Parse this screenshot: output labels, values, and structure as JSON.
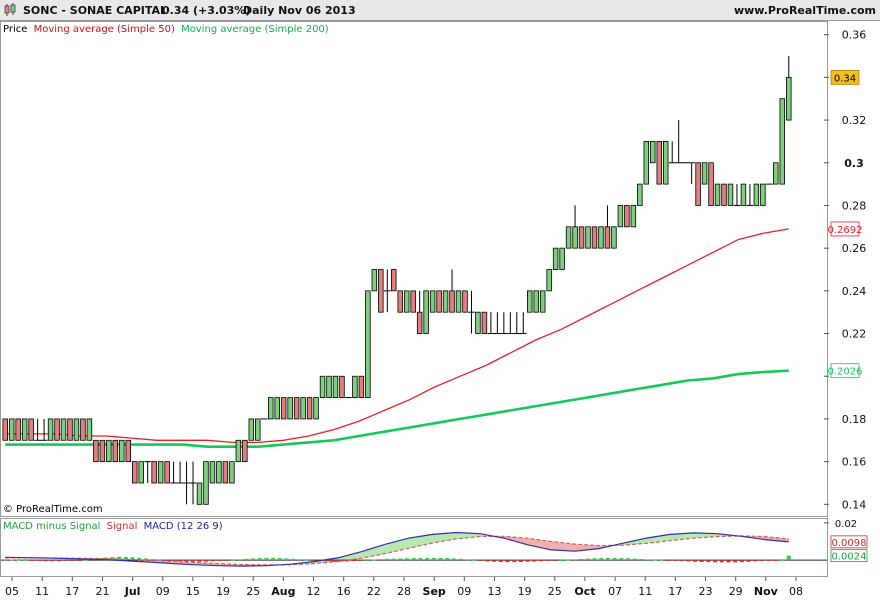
{
  "header": {
    "icon": "candlestick-icon",
    "title": "SONC - SONAE CAPITAL",
    "quote": "0.34 (+3.03%)",
    "period": "Daily  Nov 06 2013",
    "site": "www.ProRealTime.com"
  },
  "legend": {
    "price": "Price",
    "ma50": "Moving average (Simple 50)",
    "ma200": "Moving average (Simple 200)"
  },
  "copyright": "© ProRealTime.com",
  "macd_legend": {
    "hist": "MACD minus Signal",
    "signal": "Signal",
    "macd": "MACD (12 26 9)"
  },
  "colors": {
    "up": "#7ed07e",
    "down": "#e08080",
    "ma50": "#e8202a",
    "ma200": "#16c85a",
    "macd": "#3030b0",
    "signal": "#d06060",
    "price_tag": "#f0c020",
    "bg_header": "#e8e8e8"
  },
  "chart_data": [
    {
      "type": "candlestick",
      "title": "SONC - SONAE CAPITAL",
      "ylim": [
        0.135,
        0.365
      ],
      "y_ticks": [
        0.14,
        0.16,
        0.18,
        0.2,
        0.22,
        0.24,
        0.26,
        0.28,
        0.3,
        0.32,
        0.34,
        0.36
      ],
      "y_tick_labels": [
        "0.14",
        "0.16",
        "0.18",
        "",
        "0.22",
        "0.24",
        "0.26",
        "0.28",
        "0.3",
        "0.32",
        "",
        "0.36"
      ],
      "x_labels": [
        "05",
        "11",
        "17",
        "21",
        "Jul",
        "09",
        "15",
        "19",
        "25",
        "Aug",
        "12",
        "16",
        "22",
        "28",
        "Sep",
        "09",
        "13",
        "19",
        "25",
        "Oct",
        "07",
        "11",
        "17",
        "23",
        "29",
        "Nov",
        "08"
      ],
      "candles": [
        [
          0.18,
          0.18,
          0.17,
          0.17
        ],
        [
          0.17,
          0.18,
          0.17,
          0.18
        ],
        [
          0.18,
          0.18,
          0.17,
          0.17
        ],
        [
          0.17,
          0.18,
          0.17,
          0.18
        ],
        [
          0.18,
          0.18,
          0.17,
          0.17
        ],
        [
          0.17,
          0.18,
          0.17,
          0.17
        ],
        [
          0.17,
          0.18,
          0.17,
          0.17
        ],
        [
          0.17,
          0.18,
          0.17,
          0.18
        ],
        [
          0.18,
          0.18,
          0.17,
          0.17
        ],
        [
          0.17,
          0.18,
          0.17,
          0.18
        ],
        [
          0.18,
          0.18,
          0.17,
          0.17
        ],
        [
          0.17,
          0.18,
          0.17,
          0.18
        ],
        [
          0.18,
          0.18,
          0.17,
          0.17
        ],
        [
          0.17,
          0.18,
          0.17,
          0.18
        ],
        [
          0.17,
          0.17,
          0.16,
          0.16
        ],
        [
          0.17,
          0.17,
          0.16,
          0.16
        ],
        [
          0.16,
          0.17,
          0.16,
          0.17
        ],
        [
          0.17,
          0.17,
          0.16,
          0.16
        ],
        [
          0.16,
          0.17,
          0.16,
          0.17
        ],
        [
          0.17,
          0.17,
          0.16,
          0.16
        ],
        [
          0.16,
          0.16,
          0.15,
          0.15
        ],
        [
          0.15,
          0.16,
          0.15,
          0.16
        ],
        [
          0.16,
          0.16,
          0.15,
          0.16
        ],
        [
          0.16,
          0.16,
          0.15,
          0.15
        ],
        [
          0.15,
          0.16,
          0.15,
          0.16
        ],
        [
          0.16,
          0.16,
          0.15,
          0.15
        ],
        [
          0.15,
          0.16,
          0.15,
          0.15
        ],
        [
          0.15,
          0.16,
          0.15,
          0.15
        ],
        [
          0.15,
          0.16,
          0.14,
          0.15
        ],
        [
          0.15,
          0.16,
          0.14,
          0.15
        ],
        [
          0.14,
          0.15,
          0.14,
          0.15
        ],
        [
          0.14,
          0.16,
          0.14,
          0.16
        ],
        [
          0.15,
          0.16,
          0.15,
          0.16
        ],
        [
          0.15,
          0.16,
          0.15,
          0.16
        ],
        [
          0.16,
          0.16,
          0.15,
          0.15
        ],
        [
          0.15,
          0.16,
          0.15,
          0.16
        ],
        [
          0.16,
          0.17,
          0.16,
          0.17
        ],
        [
          0.17,
          0.17,
          0.16,
          0.16
        ],
        [
          0.17,
          0.18,
          0.17,
          0.18
        ],
        [
          0.17,
          0.18,
          0.17,
          0.18
        ],
        [
          0.18,
          0.18,
          0.18,
          0.18
        ],
        [
          0.18,
          0.19,
          0.18,
          0.19
        ],
        [
          0.18,
          0.19,
          0.18,
          0.19
        ],
        [
          0.19,
          0.19,
          0.18,
          0.18
        ],
        [
          0.18,
          0.19,
          0.18,
          0.19
        ],
        [
          0.19,
          0.19,
          0.18,
          0.18
        ],
        [
          0.18,
          0.19,
          0.18,
          0.19
        ],
        [
          0.19,
          0.19,
          0.18,
          0.18
        ],
        [
          0.18,
          0.19,
          0.18,
          0.19
        ],
        [
          0.19,
          0.2,
          0.19,
          0.2
        ],
        [
          0.19,
          0.2,
          0.19,
          0.2
        ],
        [
          0.19,
          0.2,
          0.19,
          0.2
        ],
        [
          0.2,
          0.2,
          0.19,
          0.19
        ],
        [
          0.19,
          0.19,
          0.19,
          0.19
        ],
        [
          0.19,
          0.2,
          0.19,
          0.2
        ],
        [
          0.2,
          0.2,
          0.19,
          0.19
        ],
        [
          0.19,
          0.24,
          0.19,
          0.24
        ],
        [
          0.24,
          0.25,
          0.24,
          0.25
        ],
        [
          0.25,
          0.25,
          0.23,
          0.23
        ],
        [
          0.24,
          0.25,
          0.23,
          0.24
        ],
        [
          0.25,
          0.25,
          0.24,
          0.24
        ],
        [
          0.24,
          0.24,
          0.23,
          0.23
        ],
        [
          0.23,
          0.24,
          0.23,
          0.24
        ],
        [
          0.24,
          0.24,
          0.23,
          0.23
        ],
        [
          0.23,
          0.24,
          0.22,
          0.22
        ],
        [
          0.22,
          0.24,
          0.22,
          0.24
        ],
        [
          0.23,
          0.24,
          0.23,
          0.24
        ],
        [
          0.24,
          0.24,
          0.23,
          0.23
        ],
        [
          0.23,
          0.24,
          0.23,
          0.24
        ],
        [
          0.24,
          0.25,
          0.23,
          0.23
        ],
        [
          0.23,
          0.24,
          0.23,
          0.24
        ],
        [
          0.24,
          0.24,
          0.23,
          0.23
        ],
        [
          0.23,
          0.24,
          0.22,
          0.23
        ],
        [
          0.22,
          0.23,
          0.22,
          0.23
        ],
        [
          0.23,
          0.23,
          0.22,
          0.22
        ],
        [
          0.22,
          0.23,
          0.22,
          0.22
        ],
        [
          0.22,
          0.23,
          0.22,
          0.22
        ],
        [
          0.22,
          0.23,
          0.22,
          0.22
        ],
        [
          0.22,
          0.23,
          0.22,
          0.22
        ],
        [
          0.22,
          0.23,
          0.22,
          0.22
        ],
        [
          0.22,
          0.23,
          0.22,
          0.22
        ],
        [
          0.23,
          0.24,
          0.23,
          0.24
        ],
        [
          0.23,
          0.24,
          0.23,
          0.24
        ],
        [
          0.23,
          0.24,
          0.23,
          0.24
        ],
        [
          0.24,
          0.25,
          0.24,
          0.25
        ],
        [
          0.25,
          0.26,
          0.25,
          0.26
        ],
        [
          0.25,
          0.26,
          0.25,
          0.26
        ],
        [
          0.26,
          0.27,
          0.26,
          0.27
        ],
        [
          0.26,
          0.28,
          0.26,
          0.27
        ],
        [
          0.27,
          0.27,
          0.26,
          0.26
        ],
        [
          0.26,
          0.27,
          0.26,
          0.27
        ],
        [
          0.27,
          0.27,
          0.26,
          0.26
        ],
        [
          0.26,
          0.27,
          0.26,
          0.27
        ],
        [
          0.27,
          0.28,
          0.26,
          0.26
        ],
        [
          0.26,
          0.27,
          0.26,
          0.27
        ],
        [
          0.27,
          0.28,
          0.27,
          0.28
        ],
        [
          0.28,
          0.28,
          0.27,
          0.27
        ],
        [
          0.27,
          0.28,
          0.27,
          0.28
        ],
        [
          0.28,
          0.29,
          0.28,
          0.29
        ],
        [
          0.29,
          0.31,
          0.29,
          0.31
        ],
        [
          0.3,
          0.31,
          0.3,
          0.31
        ],
        [
          0.31,
          0.31,
          0.29,
          0.29
        ],
        [
          0.29,
          0.31,
          0.29,
          0.31
        ],
        [
          0.3,
          0.31,
          0.3,
          0.3
        ],
        [
          0.3,
          0.32,
          0.3,
          0.3
        ],
        [
          0.3,
          0.3,
          0.3,
          0.3
        ],
        [
          0.3,
          0.3,
          0.29,
          0.3
        ],
        [
          0.3,
          0.3,
          0.28,
          0.28
        ],
        [
          0.29,
          0.3,
          0.29,
          0.3
        ],
        [
          0.3,
          0.3,
          0.28,
          0.28
        ],
        [
          0.28,
          0.29,
          0.28,
          0.29
        ],
        [
          0.29,
          0.29,
          0.28,
          0.28
        ],
        [
          0.28,
          0.29,
          0.28,
          0.29
        ],
        [
          0.28,
          0.29,
          0.28,
          0.28
        ],
        [
          0.28,
          0.29,
          0.28,
          0.29
        ],
        [
          0.28,
          0.29,
          0.28,
          0.28
        ],
        [
          0.28,
          0.29,
          0.28,
          0.29
        ],
        [
          0.28,
          0.29,
          0.28,
          0.29
        ],
        [
          0.29,
          0.29,
          0.29,
          0.29
        ],
        [
          0.29,
          0.3,
          0.29,
          0.3
        ],
        [
          0.29,
          0.33,
          0.29,
          0.33
        ],
        [
          0.32,
          0.35,
          0.32,
          0.34
        ]
      ],
      "ma50": [
        0.173,
        0.173,
        0.173,
        0.172,
        0.172,
        0.171,
        0.17,
        0.17,
        0.17,
        0.169,
        0.169,
        0.17,
        0.172,
        0.175,
        0.179,
        0.184,
        0.189,
        0.195,
        0.2,
        0.205,
        0.211,
        0.217,
        0.222,
        0.228,
        0.234,
        0.24,
        0.246,
        0.252,
        0.258,
        0.264,
        0.267,
        0.269
      ],
      "ma200": [
        0.168,
        0.168,
        0.168,
        0.168,
        0.168,
        0.168,
        0.168,
        0.168,
        0.167,
        0.167,
        0.167,
        0.168,
        0.169,
        0.17,
        0.172,
        0.174,
        0.176,
        0.178,
        0.18,
        0.182,
        0.184,
        0.186,
        0.188,
        0.19,
        0.192,
        0.194,
        0.196,
        0.198,
        0.199,
        0.201,
        0.202,
        0.2026
      ],
      "price_labels": {
        "last": "0.34",
        "ma50": "0.2692",
        "ma200": "0.2026"
      },
      "legend": [
        "Price",
        "Moving average (Simple 50)",
        "Moving average (Simple 200)"
      ]
    },
    {
      "type": "macd",
      "title": "MACD (12 26 9)",
      "ylim": [
        -0.008,
        0.021
      ],
      "y_ticks": [
        0.02
      ],
      "y_tick_labels": [
        "0.02"
      ],
      "value_labels": {
        "macd": "0.0098",
        "hist": "0.0024"
      },
      "histogram": [
        0.0004,
        0.0003,
        0.0002,
        0.0001,
        -0.0002,
        -0.0004,
        -0.0006,
        -0.0006,
        -0.0006,
        -0.0004,
        -0.0003,
        -0.0001,
        0.0002,
        0.0006,
        0.001,
        0.0014,
        0.0016,
        0.0018,
        0.0017,
        0.0015,
        0.0012,
        0.0009,
        0.0005,
        0.0002,
        -0.0002,
        -0.0004,
        -0.0006,
        -0.0008,
        -0.0009,
        -0.0009,
        -0.0008,
        -0.0006,
        -0.0004,
        -0.0002,
        0.0001,
        0.0004,
        0.0007,
        0.0009,
        0.0011,
        0.0012,
        0.0012,
        0.0011,
        0.0009,
        0.0007,
        0.0004,
        0.0001,
        -0.0002,
        -0.0005,
        -0.0007,
        -0.0008,
        -0.0008,
        -0.0007,
        -0.0005,
        -0.0003,
        0.0,
        0.0003,
        0.0005,
        0.0007,
        0.0008,
        0.0009,
        0.001,
        0.0011,
        0.0011,
        0.0011,
        0.0012,
        0.0012,
        0.0011,
        0.0009,
        0.0007,
        0.0004,
        0.0001,
        -0.0003,
        -0.0007,
        -0.0009,
        -0.001,
        -0.0011,
        -0.0011,
        -0.001,
        -0.0009,
        -0.0008,
        -0.0006,
        -0.0004,
        -0.0002,
        0.0,
        0.0002,
        0.0004,
        0.0006,
        0.0008,
        0.001,
        0.0011,
        0.0012,
        0.0012,
        0.0011,
        0.001,
        0.0008,
        0.0006,
        0.0004,
        0.0002,
        0.0001,
        -0.0001,
        -0.0003,
        -0.0005,
        -0.0007,
        -0.0009,
        -0.001,
        -0.0011,
        -0.0012,
        -0.0012,
        -0.0012,
        -0.0012,
        -0.0011,
        -0.0009,
        -0.0007,
        -0.0005,
        -0.0003,
        -0.0001,
        0.0001,
        0.0024
      ],
      "macd": [
        0.0015,
        0.0013,
        0.0011,
        0.0007,
        0.0003,
        -0.0003,
        -0.001,
        -0.0018,
        -0.0025,
        -0.003,
        -0.0032,
        -0.003,
        -0.0022,
        -0.0008,
        0.0012,
        0.0045,
        0.0085,
        0.0118,
        0.0138,
        0.0148,
        0.0142,
        0.0118,
        0.0082,
        0.0055,
        0.0048,
        0.0062,
        0.009,
        0.0118,
        0.0138,
        0.0146,
        0.0142,
        0.0128,
        0.011,
        0.0098
      ],
      "signal": [
        0.0012,
        0.0012,
        0.0011,
        0.001,
        0.0008,
        0.0005,
        0.0,
        -0.0006,
        -0.0013,
        -0.0019,
        -0.0024,
        -0.0026,
        -0.0025,
        -0.0019,
        -0.0008,
        0.001,
        0.0035,
        0.0064,
        0.0092,
        0.0114,
        0.0127,
        0.0128,
        0.0117,
        0.01,
        0.0086,
        0.0078,
        0.008,
        0.009,
        0.0104,
        0.0118,
        0.0127,
        0.013,
        0.0126,
        0.0114
      ],
      "legend": [
        "MACD minus Signal",
        "Signal",
        "MACD (12 26 9)"
      ]
    }
  ]
}
